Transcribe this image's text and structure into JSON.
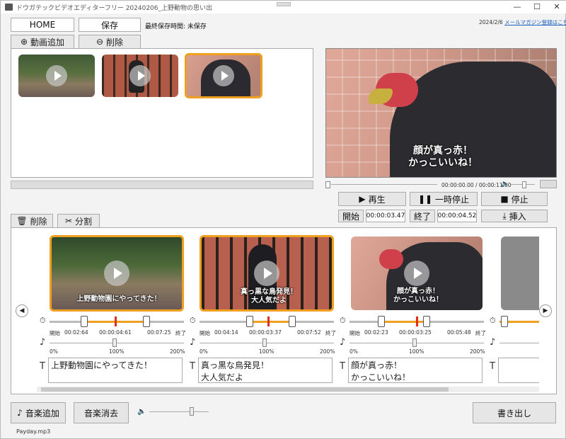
{
  "window": {
    "title": "ドウガテックビデオエディターフリー 20240206_上野動物の思い出",
    "minimize": "—",
    "maximize": "☐",
    "close": "✕"
  },
  "toolbar": {
    "home_label": "HOME",
    "save_label": "保存",
    "last_saved": "最終保存時間: 未保存"
  },
  "news": {
    "date": "2024/2/6",
    "link": "メールマガジン登録はこちら"
  },
  "media_tabs": {
    "add_label": "動画追加",
    "delete_label": "削除"
  },
  "preview": {
    "caption": "顔が真っ赤！\nかっこいいね！",
    "time": "00:00:00.00 / 00:00:11.00",
    "volume": 0.55,
    "progress": 0.0
  },
  "controls": {
    "play_label": "再生",
    "pause_label": "一時停止",
    "stop_label": "停止",
    "start_label": "開始",
    "start_time": "00:00:03.47",
    "end_label": "終了",
    "end_time": "00:00:04.52",
    "insert_label": "挿入"
  },
  "timeline_tabs": {
    "delete_label": "削除",
    "split_label": "分割"
  },
  "clips": [
    {
      "caption": "上野動物園にやってきた！",
      "start_label": "開始",
      "start": "00:02:64",
      "current": "00:00:04:61",
      "end": "00:07:25",
      "end_label": "終了",
      "pct_0": "0%",
      "pct_100": "100%",
      "pct_200": "200%",
      "text": "上野動物園にやってきた！",
      "trim_start": 0.27,
      "trim_end": 0.73,
      "marker": 0.49,
      "speed": 0.5
    },
    {
      "caption": "真っ黒な鳥発見！\n大人気だよ",
      "start_label": "開始",
      "start": "00:04:14",
      "current": "00:00:03:37",
      "end": "00:07:52",
      "end_label": "終了",
      "pct_0": "0%",
      "pct_100": "100%",
      "pct_200": "200%",
      "text": "真っ黒な鳥発見！\n大人気だよ",
      "trim_start": 0.37,
      "trim_end": 0.69,
      "marker": 0.52,
      "speed": 0.5
    },
    {
      "caption": "顔が真っ赤！\nかっこいいね！",
      "start_label": "開始",
      "start": "00:02:23",
      "current": "00:00:03:25",
      "end": "00:05:48",
      "end_label": "終了",
      "pct_0": "0%",
      "pct_100": "100%",
      "pct_200": "200%",
      "text": "顔が真っ赤！\nかっこいいね！",
      "trim_start": 0.23,
      "trim_end": 0.57,
      "marker": 0.51,
      "speed": 0.5
    }
  ],
  "bottom": {
    "add_music_label": "音楽追加",
    "remove_music_label": "音楽消去",
    "music_file": "Payday.mp3",
    "export_label": "書き出し",
    "music_volume": 0.72
  },
  "colors": {
    "accent": "#f0a020",
    "marker": "#e03010"
  },
  "icons": [
    "plus-circle-icon",
    "minus-circle-icon",
    "play-icon",
    "pause-icon",
    "stop-icon",
    "insert-icon",
    "trash-icon",
    "scissors-icon",
    "stopwatch-icon",
    "note-icon",
    "text-icon",
    "speaker-icon",
    "arrow-left-icon",
    "arrow-right-icon"
  ]
}
